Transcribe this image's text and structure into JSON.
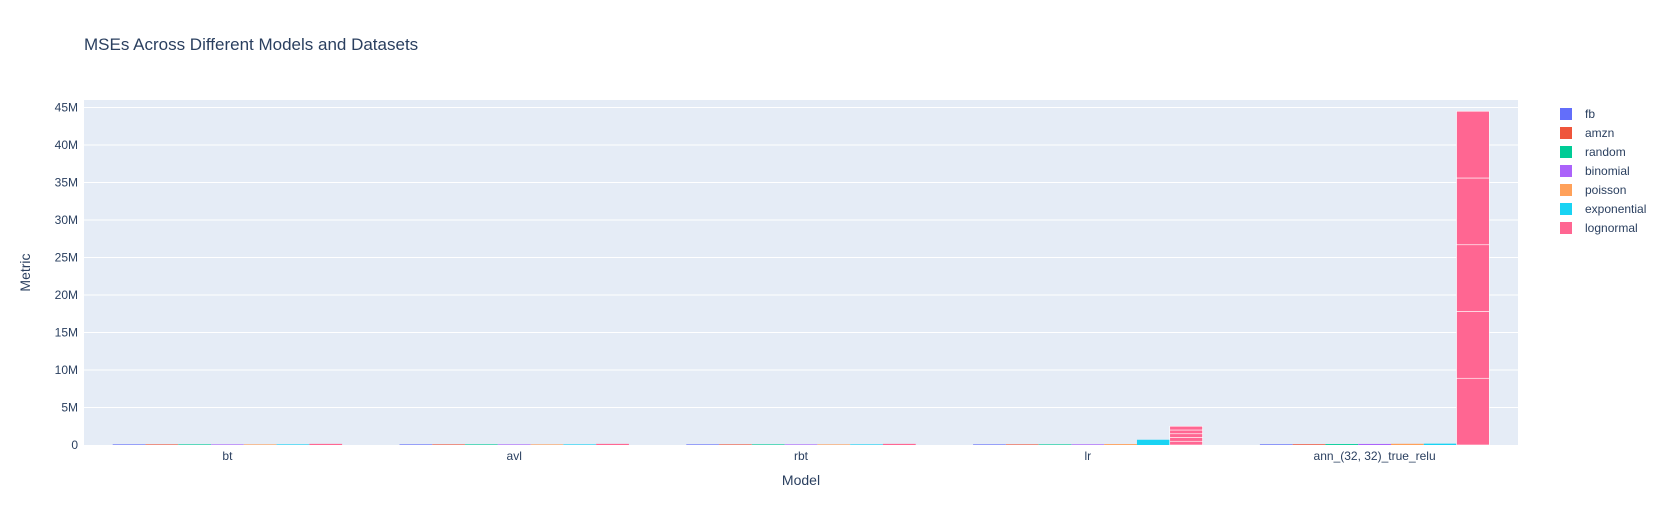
{
  "chart_data": {
    "type": "bar",
    "barmode": "group",
    "title": "MSEs Across Different Models and Datasets",
    "xlabel": "Model",
    "ylabel": "Metric",
    "categories": [
      "bt",
      "avl",
      "rbt",
      "lr",
      "ann_(32, 32)_true_relu"
    ],
    "ylim": [
      0,
      46000000
    ],
    "yticks": [
      0,
      5000000,
      10000000,
      15000000,
      20000000,
      25000000,
      30000000,
      35000000,
      40000000,
      45000000
    ],
    "ytick_labels": [
      "0",
      "5M",
      "10M",
      "15M",
      "20M",
      "25M",
      "30M",
      "35M",
      "40M",
      "45M"
    ],
    "grid": true,
    "legend_position": "right",
    "series": [
      {
        "name": "fb",
        "color": "#636efa",
        "values": [
          [
            5000
          ],
          [
            5000
          ],
          [
            5000
          ],
          [
            60000
          ],
          [
            90000
          ]
        ]
      },
      {
        "name": "amzn",
        "color": "#ef553b",
        "values": [
          [
            8000
          ],
          [
            8000
          ],
          [
            8000
          ],
          [
            70000
          ],
          [
            100000
          ]
        ]
      },
      {
        "name": "random",
        "color": "#00cc96",
        "values": [
          [
            12000
          ],
          [
            12000
          ],
          [
            12000
          ],
          [
            80000
          ],
          [
            120000
          ]
        ]
      },
      {
        "name": "binomial",
        "color": "#ab63fa",
        "values": [
          [
            15000
          ],
          [
            15000
          ],
          [
            15000
          ],
          [
            90000
          ],
          [
            140000
          ]
        ]
      },
      {
        "name": "poisson",
        "color": "#ffa15a",
        "values": [
          [
            20000
          ],
          [
            20000
          ],
          [
            20000
          ],
          [
            120000
          ],
          [
            160000
          ]
        ]
      },
      {
        "name": "exponential",
        "color": "#19d3f3",
        "values": [
          [
            30000
          ],
          [
            30000
          ],
          [
            30000
          ],
          [
            700000
          ],
          [
            180000
          ]
        ]
      },
      {
        "name": "lognormal",
        "color": "#ff6692",
        "values": [
          [
            150000
          ],
          [
            150000
          ],
          [
            150000
          ],
          [
            500000,
            500000,
            500000,
            500000,
            500000
          ],
          [
            8900000,
            8900000,
            8900000,
            8900000,
            8900000
          ]
        ]
      }
    ]
  }
}
